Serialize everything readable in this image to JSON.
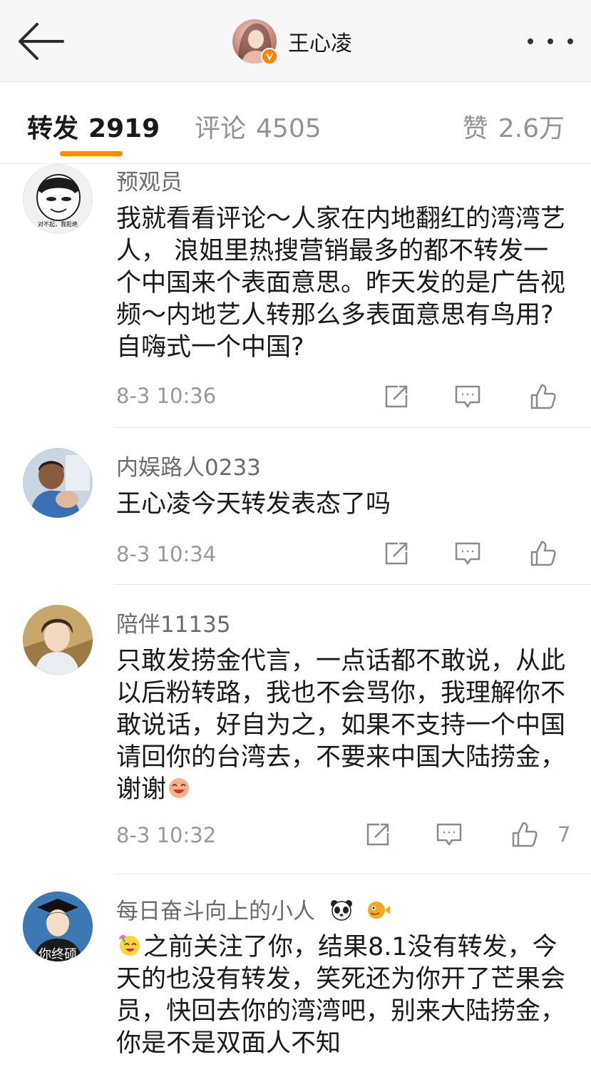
{
  "header": {
    "title": "王心凌"
  },
  "tabs": [
    {
      "label": "转发",
      "count": "2919",
      "active": true
    },
    {
      "label": "评论",
      "count": "4505",
      "active": false
    },
    {
      "label": "赞",
      "count": "2.6万",
      "active": false
    }
  ],
  "accent_color": "#ff8a00",
  "comments": [
    {
      "user": "预观员",
      "avatar_caption": "对不起，我拒绝",
      "text": "我就看看评论～人家在内地翻红的湾湾艺人， 浪姐里热搜营销最多的都不转发一个中国来个表面意思。昨天发的是广告视频～内地艺人转那么多表面意思有鸟用?自嗨式一个中国?",
      "time": "8-3 10:36",
      "likes": ""
    },
    {
      "user": "内娱路人0233",
      "text": "王心凌今天转发表态了吗",
      "time": "8-3 10:34",
      "likes": ""
    },
    {
      "user": "陪伴11135",
      "text": "只敢发捞金代言，一点话都不敢说，从此以后粉转路，我也不会骂你，我理解你不敢说话，好自为之，如果不支持一个中国请回你的台湾去，不要来中国大陆捞金，谢谢",
      "time": "8-3 10:32",
      "likes": "7"
    },
    {
      "user": "每日奋斗向上的小人",
      "avatar_caption": "你终硕",
      "text": "之前关注了你，结果8.1没有转发，今天的也没有转发，笑死还为你开了芒果会员，快回去你的湾湾吧，别来大陆捞金，你是不是双面人不知",
      "time": "",
      "likes": ""
    }
  ]
}
